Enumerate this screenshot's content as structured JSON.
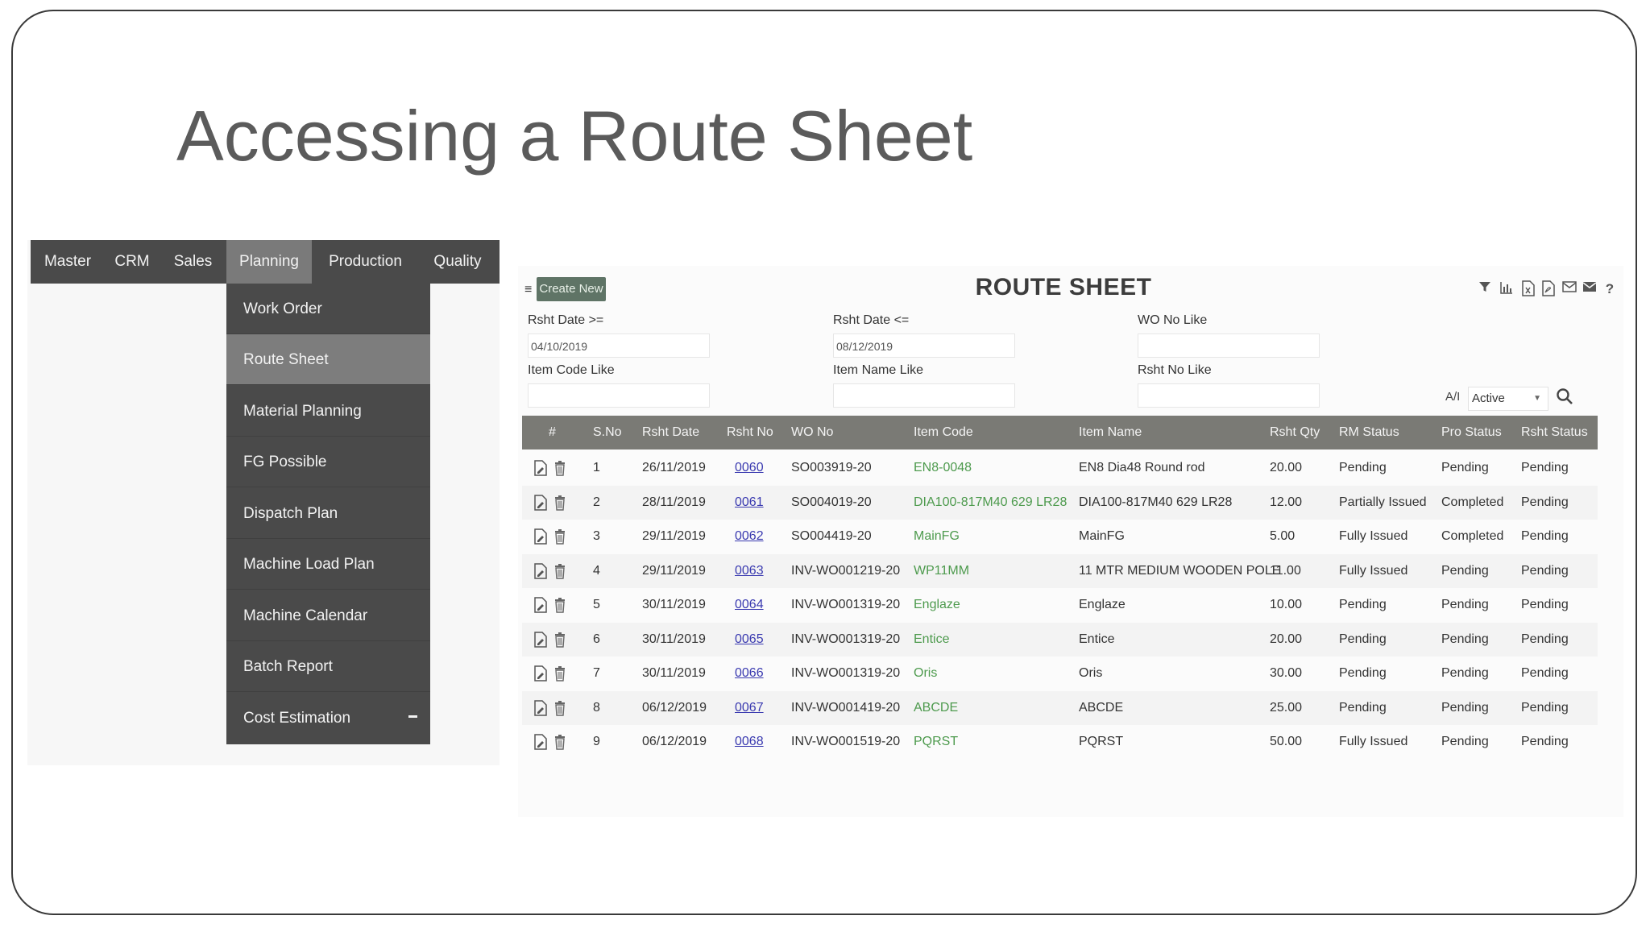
{
  "slide": {
    "title": "Accessing a Route Sheet"
  },
  "menubar": {
    "items": [
      "Master",
      "CRM",
      "Sales",
      "Planning",
      "Production",
      "Quality"
    ],
    "active": "Planning"
  },
  "dropdown": {
    "items": [
      "Work Order",
      "Route Sheet",
      "Material Planning",
      "FG Possible",
      "Dispatch Plan",
      "Machine Load Plan",
      "Machine Calendar",
      "Batch Report",
      "Cost Estimation"
    ],
    "active": "Route Sheet"
  },
  "route_sheet": {
    "create_label": "Create New",
    "title": "ROUTE SHEET",
    "toolbar_icons": [
      "filter-icon",
      "bar-chart-icon",
      "excel-icon",
      "pdf-icon",
      "mail-outline-icon",
      "mail-icon",
      "help-icon"
    ],
    "help_label": "?",
    "filters": {
      "rsht_date_from": {
        "label": "Rsht Date >=",
        "value": "04/10/2019"
      },
      "rsht_date_to": {
        "label": "Rsht Date <=",
        "value": "08/12/2019"
      },
      "wo_no": {
        "label": "WO No Like",
        "value": ""
      },
      "item_code": {
        "label": "Item Code Like",
        "value": ""
      },
      "item_name": {
        "label": "Item Name Like",
        "value": ""
      },
      "rsht_no": {
        "label": "Rsht No Like",
        "value": ""
      }
    },
    "ai": {
      "label": "A/I",
      "value": "Active"
    },
    "columns": [
      "#",
      "S.No",
      "Rsht Date",
      "Rsht No",
      "WO No",
      "Item Code",
      "Item Name",
      "Rsht Qty",
      "RM Status",
      "Pro Status",
      "Rsht Status"
    ],
    "rows": [
      [
        "1",
        "26/11/2019",
        "0060",
        "SO003919-20",
        "EN8-0048",
        "EN8 Dia48 Round rod",
        "20.00",
        "Pending",
        "Pending",
        "Pending"
      ],
      [
        "2",
        "28/11/2019",
        "0061",
        "SO004019-20",
        "DIA100-817M40 629 LR28",
        "DIA100-817M40 629 LR28",
        "12.00",
        "Partially Issued",
        "Completed",
        "Pending"
      ],
      [
        "3",
        "29/11/2019",
        "0062",
        "SO004419-20",
        "MainFG",
        "MainFG",
        "5.00",
        "Fully Issued",
        "Completed",
        "Pending"
      ],
      [
        "4",
        "29/11/2019",
        "0063",
        "INV-WO001219-20",
        "WP11MM",
        "11 MTR MEDIUM WOODEN POLE",
        "11.00",
        "Fully Issued",
        "Pending",
        "Pending"
      ],
      [
        "5",
        "30/11/2019",
        "0064",
        "INV-WO001319-20",
        "Englaze",
        "Englaze",
        "10.00",
        "Pending",
        "Pending",
        "Pending"
      ],
      [
        "6",
        "30/11/2019",
        "0065",
        "INV-WO001319-20",
        "Entice",
        "Entice",
        "20.00",
        "Pending",
        "Pending",
        "Pending"
      ],
      [
        "7",
        "30/11/2019",
        "0066",
        "INV-WO001319-20",
        "Oris",
        "Oris",
        "30.00",
        "Pending",
        "Pending",
        "Pending"
      ],
      [
        "8",
        "06/12/2019",
        "0067",
        "INV-WO001419-20",
        "ABCDE",
        "ABCDE",
        "25.00",
        "Pending",
        "Pending",
        "Pending"
      ],
      [
        "9",
        "06/12/2019",
        "0068",
        "INV-WO001519-20",
        "PQRST",
        "PQRST",
        "50.00",
        "Fully Issued",
        "Pending",
        "Pending"
      ]
    ]
  },
  "colors": {
    "menu_bg": "#4a4a4a",
    "menu_active": "#7a7a7a",
    "table_head": "#7a7a75",
    "item_code": "#4d9a4d",
    "link": "#3a3ab0"
  }
}
